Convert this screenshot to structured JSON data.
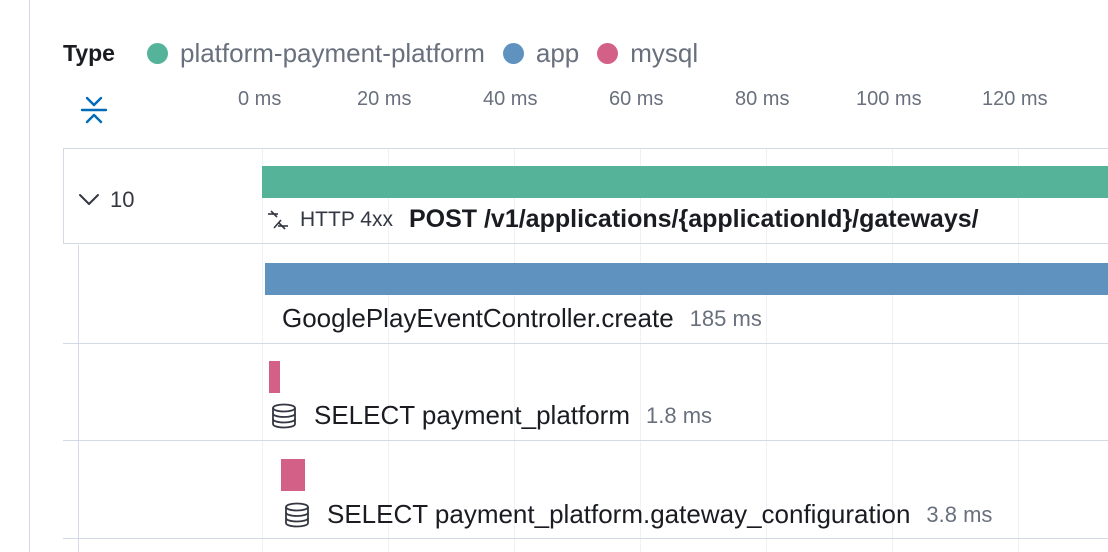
{
  "legend": {
    "title": "Type",
    "items": [
      {
        "label": "platform-payment-platform",
        "color": "#54b399"
      },
      {
        "label": "app",
        "color": "#6092c0"
      },
      {
        "label": "mysql",
        "color": "#d36086"
      }
    ]
  },
  "timeline": {
    "ticks": [
      "0 ms",
      "20 ms",
      "40 ms",
      "60 ms",
      "80 ms",
      "100 ms",
      "120 ms"
    ]
  },
  "waterfall": {
    "root": {
      "count": "10",
      "status": "HTTP 4xx",
      "name": "POST /v1/applications/{applicationId}/gateways/",
      "color": "#54b399",
      "expanded": true
    },
    "spans": [
      {
        "name": "GooglePlayEventController.create",
        "duration": "185 ms",
        "color": "#6092c0",
        "icon": ""
      },
      {
        "name": "SELECT payment_platform",
        "duration": "1.8 ms",
        "color": "#d36086",
        "icon": "database-icon"
      },
      {
        "name": "SELECT payment_platform.gateway_configuration",
        "duration": "3.8 ms",
        "color": "#d36086",
        "icon": "database-icon"
      }
    ]
  }
}
